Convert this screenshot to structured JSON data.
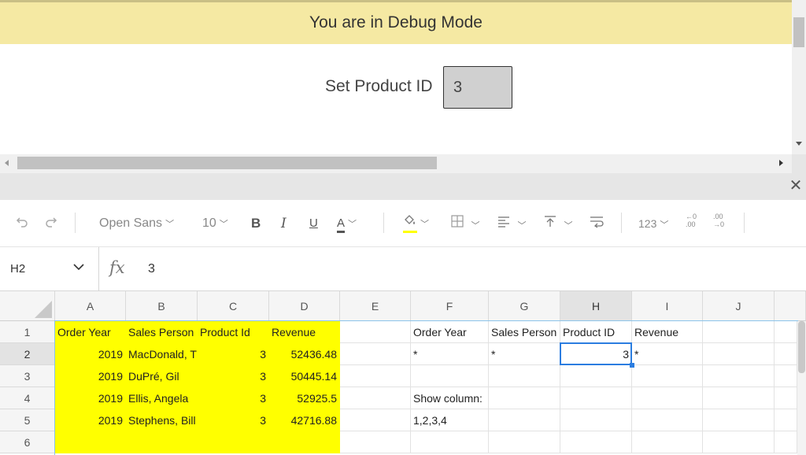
{
  "banner": {
    "text": "You are in Debug Mode"
  },
  "product_form": {
    "label": "Set Product ID",
    "value": "3"
  },
  "panel": {
    "close_icon": "close-icon"
  },
  "toolbar": {
    "undo_icon": "undo-icon",
    "redo_icon": "redo-icon",
    "font_family": "Open Sans",
    "font_size": "10",
    "bold": "B",
    "italic": "I",
    "underline": "U",
    "font_color": "A",
    "number_format": "123",
    "decimal_increase": "←0 .00",
    "decimal_decrease": ".00 →0"
  },
  "formula_bar": {
    "cell_ref": "H2",
    "fx_label": "fx",
    "value": "3"
  },
  "sheet": {
    "columns": [
      "A",
      "B",
      "C",
      "D",
      "E",
      "F",
      "G",
      "H",
      "I",
      "J"
    ],
    "rows": [
      "1",
      "2",
      "3",
      "4",
      "5",
      "6"
    ],
    "cells": {
      "A1": "Order Year",
      "B1": "Sales Person",
      "C1": "Product Id",
      "D1": "Revenue",
      "A2": "2019",
      "B2": "MacDonald, T",
      "C2": "3",
      "D2": "52436.48",
      "A3": "2019",
      "B3": "DuPré, Gil",
      "C3": "3",
      "D3": "50445.14",
      "A4": "2019",
      "B4": "Ellis, Angela",
      "C4": "3",
      "D4": "52925.5",
      "A5": "2019",
      "B5": "Stephens, Bill",
      "C5": "3",
      "D5": "42716.88",
      "F1": "Order Year",
      "G1": "Sales Person",
      "H1": "Product ID",
      "I1": "Revenue",
      "F2": "*",
      "G2": "*",
      "H2": "3",
      "I2": "*",
      "F4": "Show column:",
      "F5": "1,2,3,4"
    },
    "selected_cell": "H2",
    "highlight_color": "#ffff00",
    "selection_color": "#2b7de0"
  }
}
